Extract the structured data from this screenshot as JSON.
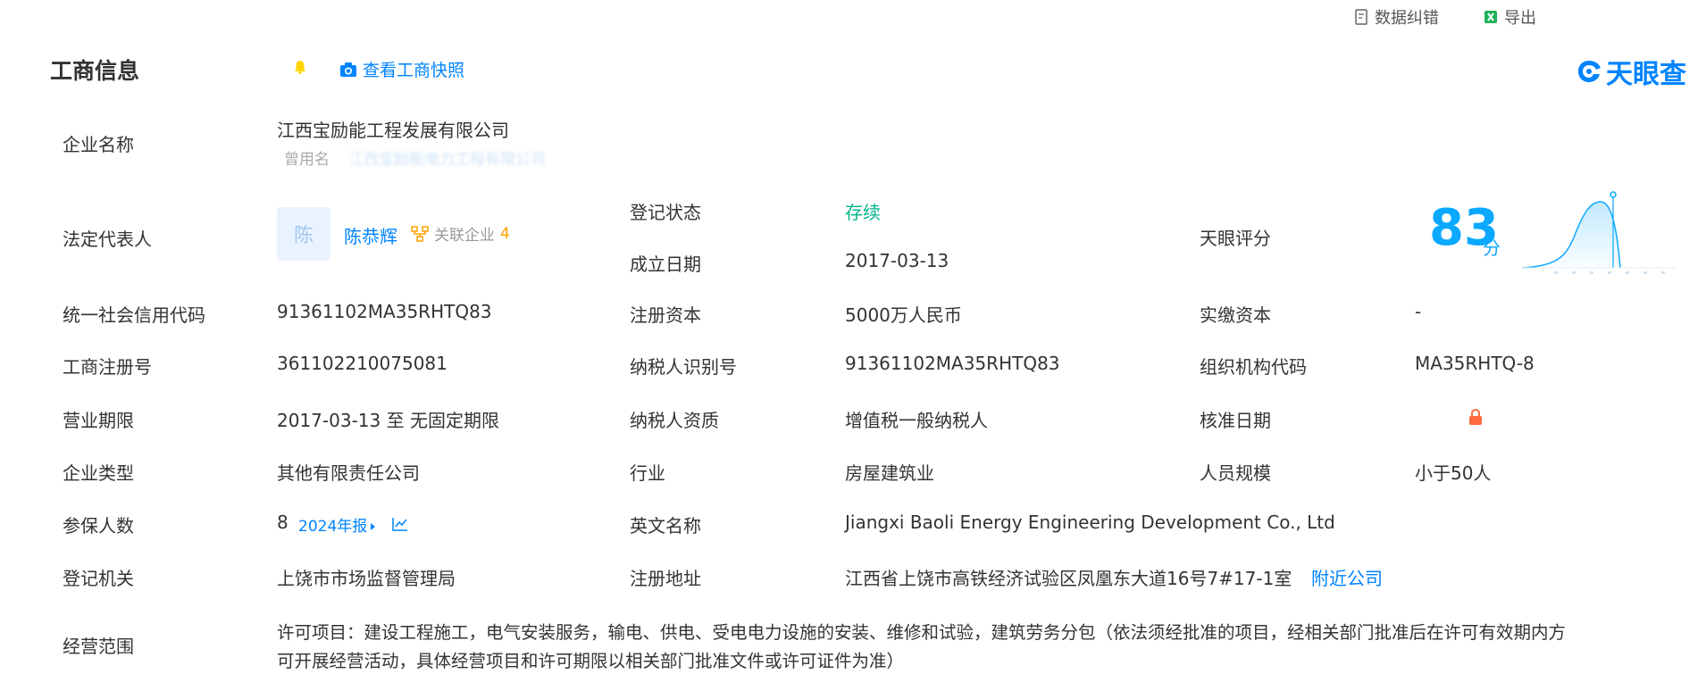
{
  "header": {
    "title": "工商信息",
    "snapshot_link": "查看工商快照",
    "data_correction": "数据纠错",
    "export": "导出",
    "logo_text": "天眼查"
  },
  "company": {
    "name_label": "企业名称",
    "name": "江西宝励能工程发展有限公司",
    "former_name_label": "曾用名",
    "former_name": "江西宝励能电力工程有限公司"
  },
  "legal_rep": {
    "label": "法定代表人",
    "avatar_char": "陈",
    "name": "陈恭辉",
    "related_label": "关联企业",
    "related_count": "4"
  },
  "reg_status": {
    "label": "登记状态",
    "value": "存续"
  },
  "found_date": {
    "label": "成立日期",
    "value": "2017-03-13"
  },
  "score": {
    "label": "天眼评分",
    "value": "83",
    "unit": "分"
  },
  "rows": {
    "credit_code": {
      "label": "统一社会信用代码",
      "value": "91361102MA35RHTQ83"
    },
    "reg_capital": {
      "label": "注册资本",
      "value": "5000万人民币"
    },
    "paid_capital": {
      "label": "实缴资本",
      "value": "-"
    },
    "reg_no": {
      "label": "工商注册号",
      "value": "361102210075081"
    },
    "taxpayer_id": {
      "label": "纳税人识别号",
      "value": "91361102MA35RHTQ83"
    },
    "org_code": {
      "label": "组织机构代码",
      "value": "MA35RHTQ-8"
    },
    "biz_period": {
      "label": "营业期限",
      "value": "2017-03-13 至 无固定期限"
    },
    "taxpayer_qual": {
      "label": "纳税人资质",
      "value": "增值税一般纳税人"
    },
    "approve_date": {
      "label": "核准日期"
    },
    "company_type": {
      "label": "企业类型",
      "value": "其他有限责任公司"
    },
    "industry": {
      "label": "行业",
      "value": "房屋建筑业"
    },
    "staff_size": {
      "label": "人员规模",
      "value": "小于50人"
    },
    "insured": {
      "label": "参保人数",
      "value": "8",
      "report_link": "2024年报"
    },
    "english_name": {
      "label": "英文名称",
      "value": "Jiangxi Baoli Energy Engineering Development Co., Ltd"
    },
    "reg_authority": {
      "label": "登记机关",
      "value": "上饶市市场监督管理局"
    },
    "reg_address": {
      "label": "注册地址",
      "value": "江西省上饶市高铁经济试验区凤凰东大道16号7#17-1室",
      "nearby_link": "附近公司"
    },
    "scope": {
      "label": "经营范围",
      "line1": "许可项目：建设工程施工，电气安装服务，输电、供电、受电电力设施的安装、维修和试验，建筑劳务分包（依法须经批准的项目，经相关部门批准后在许可有效期内方",
      "line2": "可开展经营活动，具体经营项目和许可期限以相关部门批准文件或许可证件为准）"
    }
  },
  "colors": {
    "accent": "#0084ff",
    "status_green": "#00b389",
    "score": "#0aa8ff",
    "related": "#ff9f00",
    "lock": "#ff6b3d"
  },
  "icons": {
    "bell": "bell-icon",
    "camera": "camera-icon",
    "correction": "edit-doc-icon",
    "export": "excel-icon",
    "lock": "lock-icon",
    "trend": "trend-chart-icon",
    "related": "network-icon"
  }
}
